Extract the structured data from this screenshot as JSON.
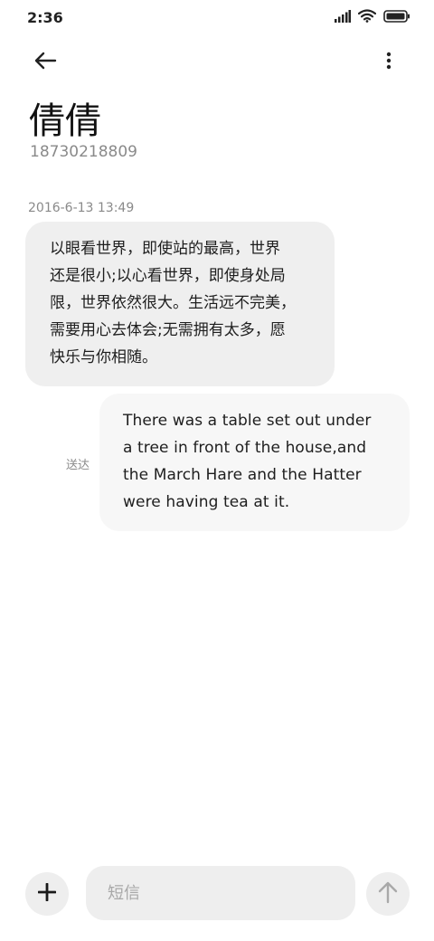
{
  "status_bar": {
    "time": "2:36",
    "icons": [
      "signal-icon",
      "wifi-icon",
      "battery-icon"
    ]
  },
  "header": {
    "back_icon": "back-arrow-icon",
    "more_icon": "more-vertical-icon",
    "contact_name": "倩倩",
    "contact_number": "18730218809"
  },
  "conversation": {
    "timestamp": "2016-6-13 13:49",
    "incoming": {
      "lines": [
        "以眼看世界，即使站的最高，世界",
        "还是很小;以心看世界，即使身处局",
        "限，世界依然很大。生活远不完美，",
        "需要用心去体会;无需拥有太多，愿",
        "快乐与你相随。"
      ]
    },
    "outgoing": {
      "lines": [
        "There was a table set out under",
        "a tree in front of the house,and",
        "the March Hare and the Hatter",
        "were having tea at it."
      ],
      "status": "送达"
    }
  },
  "composer": {
    "add_icon": "plus-icon",
    "placeholder": "短信",
    "value": "",
    "send_icon": "arrow-up-icon"
  }
}
